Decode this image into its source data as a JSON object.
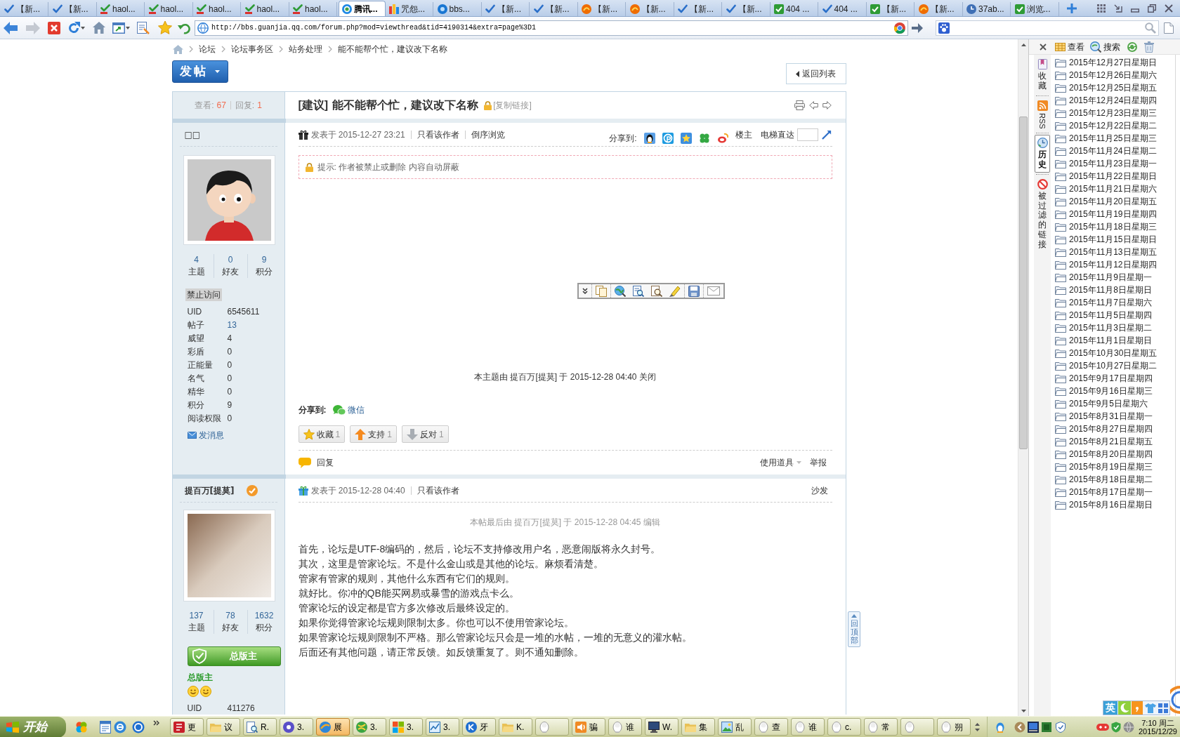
{
  "browser": {
    "tabs": [
      {
        "label": "【新...",
        "kind": "tick",
        "selected": false
      },
      {
        "label": "【新...",
        "kind": "tick",
        "selected": false
      },
      {
        "label": "haol...",
        "kind": "hao",
        "selected": false
      },
      {
        "label": "haol...",
        "kind": "hao",
        "selected": false
      },
      {
        "label": "haol...",
        "kind": "hao",
        "selected": false
      },
      {
        "label": "haol...",
        "kind": "hao",
        "selected": false
      },
      {
        "label": "haol...",
        "kind": "hao",
        "selected": false
      },
      {
        "label": "腾讯...",
        "kind": "ring",
        "selected": true
      },
      {
        "label": "咒怨...",
        "kind": "bars",
        "selected": false
      },
      {
        "label": "bbs...",
        "kind": "circle",
        "selected": false
      },
      {
        "label": "【新...",
        "kind": "tick",
        "selected": false
      },
      {
        "label": "【新...",
        "kind": "tick",
        "selected": false
      },
      {
        "label": "【新...",
        "kind": "ball",
        "selected": false
      },
      {
        "label": "【新...",
        "kind": "ball",
        "selected": false
      },
      {
        "label": "【新...",
        "kind": "tick",
        "selected": false
      },
      {
        "label": "【新...",
        "kind": "tick",
        "selected": false
      },
      {
        "label": "404 ...",
        "kind": "square",
        "selected": false
      },
      {
        "label": "404 ...",
        "kind": "tick",
        "selected": false
      },
      {
        "label": "【新...",
        "kind": "square",
        "selected": false
      },
      {
        "label": "【新...",
        "kind": "ball",
        "selected": false
      },
      {
        "label": "37ab...",
        "kind": "dial",
        "selected": false
      },
      {
        "label": "浏览...",
        "kind": "square",
        "selected": false
      }
    ],
    "address": "http://bbs.guanjia.qq.com/forum.php?mod=viewthread&tid=4190314&extra=page%3D1"
  },
  "forum": {
    "breadcrumb": [
      "论坛",
      "论坛事务区",
      "站务处理",
      "能不能帮个忙，建议改下名称"
    ],
    "new_post_button": "发帖",
    "back_button": "返回列表",
    "thread": {
      "views_label": "查看:",
      "views": "67",
      "replies_label": "回复:",
      "replies": "1",
      "category": "[建议]",
      "title": "能不能帮个忙，建议改下名称",
      "copy_link": "[复制链接]"
    },
    "posts": [
      {
        "author": "□□",
        "author_icon": {
          "kind": "member"
        },
        "avatar": {
          "kind": "cartoon"
        },
        "stats": [
          {
            "value": "4",
            "label": "主题"
          },
          {
            "value": "0",
            "label": "好友"
          },
          {
            "value": "9",
            "label": "积分"
          }
        ],
        "group": "禁止访问",
        "fields": [
          {
            "label": "UID",
            "value": "6545611",
            "link": false
          },
          {
            "label": "帖子",
            "value": "13",
            "link": true
          },
          {
            "label": "威望",
            "value": "4",
            "link": false
          },
          {
            "label": "彩盾",
            "value": "0",
            "link": false
          },
          {
            "label": "正能量",
            "value": "0",
            "link": false
          },
          {
            "label": "名气",
            "value": "0",
            "link": false
          },
          {
            "label": "精华",
            "value": "0",
            "link": false
          },
          {
            "label": "积分",
            "value": "9",
            "link": false
          },
          {
            "label": "阅读权限",
            "value": "0",
            "link": false
          }
        ],
        "message_link": "发消息",
        "posted": "发表于 2015-12-27 23:21",
        "links": [
          "只看该作者",
          "倒序浏览"
        ],
        "share_label": "分享到:",
        "floor": "楼主",
        "jump_label": "电梯直达",
        "notice": "提示: 作者被禁止或删除 内容自动屏蔽",
        "closed_note": "本主题由 提百万[提莫] 于 2015-12-28 04:40 关闭",
        "share_bottom": {
          "label": "分享到:",
          "link": "微信"
        },
        "actions": [
          {
            "label": "收藏",
            "count": "1",
            "kind": "star"
          },
          {
            "label": "支持",
            "count": "1",
            "kind": "up"
          },
          {
            "label": "反对",
            "count": "1",
            "kind": "down"
          }
        ],
        "reply": "回复",
        "tools": "使用道具",
        "report": "举报"
      },
      {
        "author": "提百万[提莫]",
        "verified": true,
        "author_icon": {
          "kind": "admin"
        },
        "avatar": {
          "kind": "photo"
        },
        "stats": [
          {
            "value": "137",
            "label": "主题"
          },
          {
            "value": "78",
            "label": "好友"
          },
          {
            "value": "1632",
            "label": "积分"
          }
        ],
        "rank_badge": "总版主",
        "rank": "总版主",
        "fields": [
          {
            "label": "UID",
            "value": "411276",
            "link": false
          }
        ],
        "posted": "发表于 2015-12-28 04:40",
        "links": [
          "只看该作者"
        ],
        "floor": "沙发",
        "edit_note": "本帖最后由 提百万[提莫] 于 2015-12-28 04:45 编辑",
        "body": [
          "首先，论坛是UTF-8编码的，然后，论坛不支持修改用户名，恶意闹版将永久封号。",
          "其次，这里是管家论坛。不是什么金山或是其他的论坛。麻烦看清楚。",
          "管家有管家的规则，其他什么东西有它们的规则。",
          "就好比。你冲的QB能买网易或暴雪的游戏点卡么。",
          "管家论坛的设定都是官方多次修改后最终设定的。",
          "如果你觉得管家论坛规则限制太多。你也可以不使用管家论坛。",
          "如果管家论坛规则限制不严格。那么管家论坛只会是一堆的水帖，一堆的无意义的灌水帖。",
          "后面还有其他问题，请正常反馈。如反馈重复了。则不通知删除。"
        ]
      }
    ],
    "back_to_top": "回顶部"
  },
  "side_panel": {
    "view_button": "查看",
    "search_button": "搜索",
    "tabs": [
      {
        "label": "收藏",
        "kind": "bookmark",
        "rotated": false,
        "selected": false
      },
      {
        "label": "RSS",
        "kind": "rss",
        "rotated": true,
        "selected": false
      },
      {
        "label": "历史",
        "kind": "history",
        "rotated": false,
        "selected": true
      },
      {
        "label": "被过滤的链接",
        "kind": "blocked",
        "rotated": false,
        "selected": false
      }
    ],
    "history": [
      "2015年12月27日星期日",
      "2015年12月26日星期六",
      "2015年12月25日星期五",
      "2015年12月24日星期四",
      "2015年12月23日星期三",
      "2015年12月22日星期二",
      "2015年11月25日星期三",
      "2015年11月24日星期二",
      "2015年11月23日星期一",
      "2015年11月22日星期日",
      "2015年11月21日星期六",
      "2015年11月20日星期五",
      "2015年11月19日星期四",
      "2015年11月18日星期三",
      "2015年11月15日星期日",
      "2015年11月13日星期五",
      "2015年11月12日星期四",
      "2015年11月9日星期一",
      "2015年11月8日星期日",
      "2015年11月7日星期六",
      "2015年11月5日星期四",
      "2015年11月3日星期二",
      "2015年11月1日星期日",
      "2015年10月30日星期五",
      "2015年10月27日星期二",
      "2015年9月17日星期四",
      "2015年9月16日星期三",
      "2015年9月5日星期六",
      "2015年8月31日星期一",
      "2015年8月27日星期四",
      "2015年8月21日星期五",
      "2015年8月20日星期四",
      "2015年8月19日星期三",
      "2015年8月18日星期二",
      "2015年8月17日星期一",
      "2015年8月16日星期日"
    ]
  },
  "taskbar": {
    "start": "开始",
    "tasks": [
      {
        "label": "更",
        "kind": "book",
        "selected": false
      },
      {
        "label": "议",
        "kind": "folder",
        "selected": false
      },
      {
        "label": "R.",
        "kind": "doc",
        "selected": false
      },
      {
        "label": "3.",
        "kind": "disc",
        "selected": false
      },
      {
        "label": "展",
        "kind": "browser",
        "selected": true
      },
      {
        "label": "3.",
        "kind": "ball",
        "selected": false
      },
      {
        "label": "3.",
        "kind": "tiles",
        "selected": false
      },
      {
        "label": "3.",
        "kind": "chart",
        "selected": false
      },
      {
        "label": "牙",
        "kind": "kcircle",
        "selected": false
      },
      {
        "label": "K.",
        "kind": "folder",
        "selected": false
      },
      {
        "kind": "penguin",
        "selected": false
      },
      {
        "label": "骗",
        "kind": "speaker",
        "selected": false
      },
      {
        "label": "谁",
        "kind": "penguin",
        "selected": false
      },
      {
        "label": "W.",
        "kind": "monitor",
        "selected": false
      },
      {
        "label": "集",
        "kind": "folder",
        "selected": false
      },
      {
        "label": "乱",
        "kind": "picture",
        "selected": false
      },
      {
        "label": "查",
        "kind": "penguin",
        "selected": false
      },
      {
        "label": "谁",
        "kind": "penguin",
        "selected": false
      },
      {
        "label": "c.",
        "kind": "penguin",
        "selected": false
      },
      {
        "label": "常",
        "kind": "penguin",
        "selected": false
      },
      {
        "kind": "penguin",
        "selected": false
      },
      {
        "label": "朔",
        "kind": "penguin",
        "selected": false
      }
    ],
    "ime": "英",
    "time": "7:10 周二",
    "date": "2015/12/29"
  }
}
